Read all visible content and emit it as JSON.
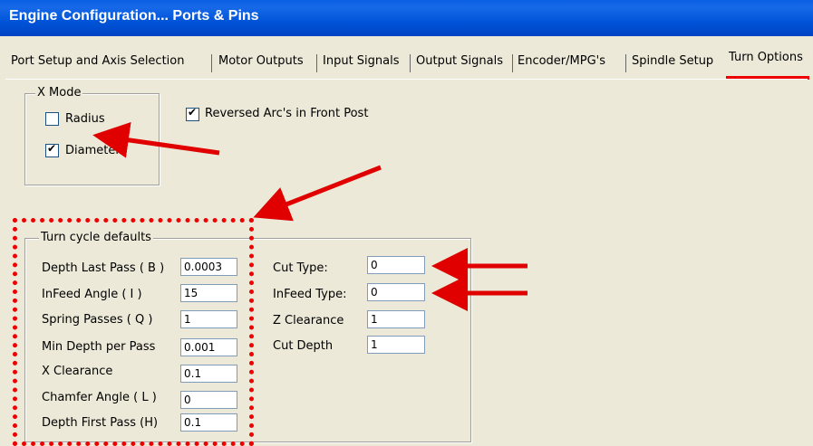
{
  "window": {
    "title": "Engine Configuration... Ports & Pins"
  },
  "tabs": [
    {
      "label": "Port Setup and Axis Selection"
    },
    {
      "label": "Motor Outputs"
    },
    {
      "label": "Input Signals"
    },
    {
      "label": "Output Signals"
    },
    {
      "label": "Encoder/MPG's"
    },
    {
      "label": "Spindle Setup"
    },
    {
      "label": "Turn Options"
    }
  ],
  "active_tab": "Turn Options",
  "xmode": {
    "legend": "X Mode",
    "radius": {
      "label": "Radius",
      "checked": false
    },
    "diameter": {
      "label": "Diameter",
      "checked": true
    }
  },
  "reversed_arcs": {
    "label": "Reversed Arc's in Front Post",
    "checked": true
  },
  "turn_cycle": {
    "legend": "Turn cycle defaults",
    "left_fields": [
      {
        "label": "Depth Last Pass ( B )",
        "value": "0.0003"
      },
      {
        "label": "InFeed Angle ( I )",
        "value": "15"
      },
      {
        "label": "Spring Passes ( Q )",
        "value": "1"
      },
      {
        "label": "Min Depth per Pass",
        "value": "0.001"
      },
      {
        "label": "X Clearance",
        "value": "0.1"
      },
      {
        "label": "Chamfer Angle ( L )",
        "value": "0"
      },
      {
        "label": "Depth First Pass (H)",
        "value": "0.1"
      }
    ],
    "right_fields": [
      {
        "label": "Cut Type:",
        "value": "0"
      },
      {
        "label": "InFeed Type:",
        "value": "0"
      },
      {
        "label": "Z Clearance",
        "value": "1"
      },
      {
        "label": "Cut Depth",
        "value": "1"
      }
    ]
  },
  "annotation_color": "#e00000"
}
